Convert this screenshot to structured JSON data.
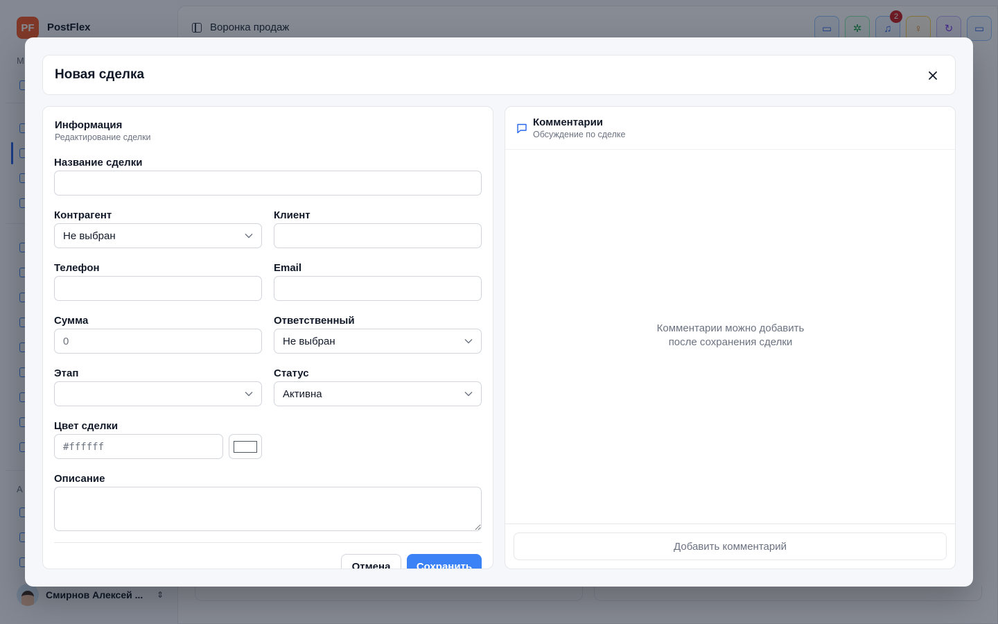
{
  "app": {
    "brand": "PostFlex",
    "logo_text": "PF",
    "sidebar_section_main": "М",
    "sidebar_section_admin": "А",
    "user_name": "Смирнов Алексей ...",
    "breadcrumb": "Воронка продаж",
    "notifications_count": "2",
    "accent_color": "#3b82f6"
  },
  "modal": {
    "title": "Новая сделка",
    "info": {
      "title": "Информация",
      "subtitle": "Редактирование сделки"
    },
    "fields": {
      "deal_name": {
        "label": "Название сделки",
        "value": "",
        "placeholder": ""
      },
      "counterparty": {
        "label": "Контрагент",
        "value": "Не выбран"
      },
      "client": {
        "label": "Клиент",
        "value": "",
        "placeholder": ""
      },
      "phone": {
        "label": "Телефон",
        "value": "",
        "placeholder": ""
      },
      "email": {
        "label": "Email",
        "value": "",
        "placeholder": ""
      },
      "amount": {
        "label": "Сумма",
        "value": "",
        "placeholder": "0"
      },
      "responsible": {
        "label": "Ответственный",
        "value": "Не выбран"
      },
      "stage": {
        "label": "Этап",
        "value": ""
      },
      "status": {
        "label": "Статус",
        "value": "Активна"
      },
      "color": {
        "label": "Цвет сделки",
        "value": "",
        "placeholder": "#ffffff",
        "swatch": "#ffffff"
      },
      "description": {
        "label": "Описание",
        "value": "",
        "placeholder": ""
      }
    },
    "buttons": {
      "cancel": "Отмена",
      "save": "Сохранить"
    },
    "comments": {
      "title": "Комментарии",
      "subtitle": "Обсуждение по сделке",
      "empty_line1": "Комментарии можно добавить",
      "empty_line2": "после сохранения сделки",
      "add_button": "Добавить комментарий"
    }
  }
}
